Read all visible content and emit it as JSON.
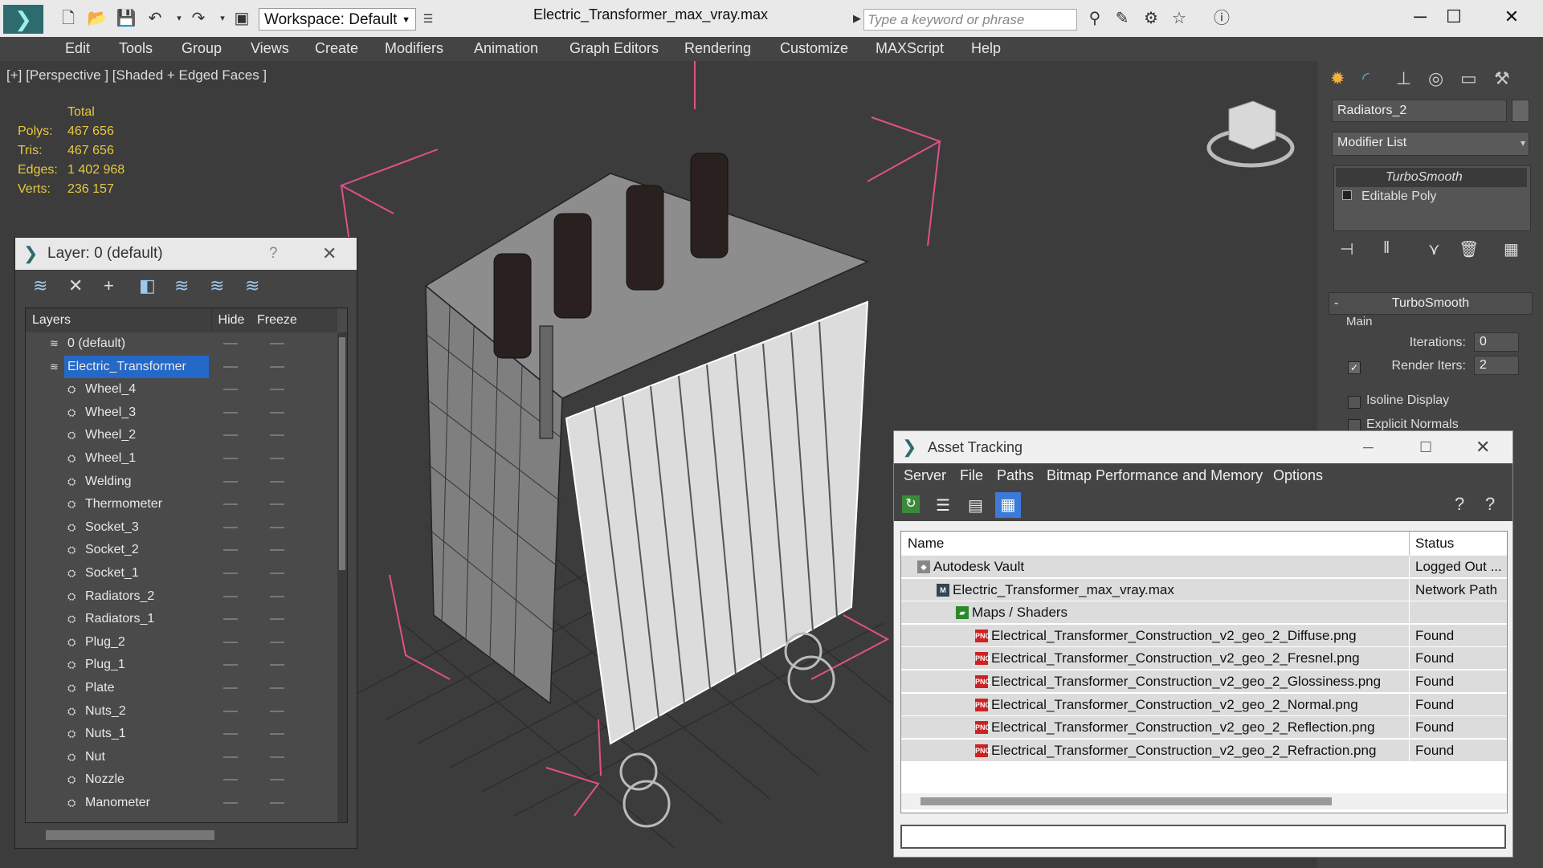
{
  "app": {
    "window_title": "Electric_Transformer_max_vray.max",
    "workspace": "Workspace: Default",
    "search_placeholder": "Type a keyword or phrase"
  },
  "menu": [
    "Edit",
    "Tools",
    "Group",
    "Views",
    "Create",
    "Modifiers",
    "Animation",
    "Graph Editors",
    "Rendering",
    "Customize",
    "MAXScript",
    "Help"
  ],
  "viewport": {
    "label": "[+] [Perspective ] [Shaded + Edged Faces ]",
    "stats": {
      "header": "Total",
      "rows": [
        {
          "k": "Polys:",
          "v": "467 656"
        },
        {
          "k": "Tris:",
          "v": "467 656"
        },
        {
          "k": "Edges:",
          "v": "1 402 968"
        },
        {
          "k": "Verts:",
          "v": "236 157"
        }
      ]
    }
  },
  "command_panel": {
    "object_name": "Radiators_2",
    "modifier_list": "Modifier List",
    "stack": [
      "TurboSmooth",
      "Editable Poly"
    ],
    "rollout_title": "TurboSmooth",
    "group_main": "Main",
    "iterations_label": "Iterations:",
    "iterations_value": "0",
    "render_iters_label": "Render Iters:",
    "render_iters_value": "2",
    "isoline_label": "Isoline Display",
    "explicit_label": "Explicit Normals"
  },
  "layer_dialog": {
    "title": "Layer: 0 (default)",
    "help": "?",
    "col_layers": "Layers",
    "col_hide": "Hide",
    "col_freeze": "Freeze",
    "rows": [
      {
        "name": "0 (default)",
        "level": 0
      },
      {
        "name": "Electric_Transformer",
        "level": 0,
        "selected": true
      },
      {
        "name": "Wheel_4",
        "level": 1
      },
      {
        "name": "Wheel_3",
        "level": 1
      },
      {
        "name": "Wheel_2",
        "level": 1
      },
      {
        "name": "Wheel_1",
        "level": 1
      },
      {
        "name": "Welding",
        "level": 1
      },
      {
        "name": "Thermometer",
        "level": 1
      },
      {
        "name": "Socket_3",
        "level": 1
      },
      {
        "name": "Socket_2",
        "level": 1
      },
      {
        "name": "Socket_1",
        "level": 1
      },
      {
        "name": "Radiators_2",
        "level": 1
      },
      {
        "name": "Radiators_1",
        "level": 1
      },
      {
        "name": "Plug_2",
        "level": 1
      },
      {
        "name": "Plug_1",
        "level": 1
      },
      {
        "name": "Plate",
        "level": 1
      },
      {
        "name": "Nuts_2",
        "level": 1
      },
      {
        "name": "Nuts_1",
        "level": 1
      },
      {
        "name": "Nut",
        "level": 1
      },
      {
        "name": "Nozzle",
        "level": 1
      },
      {
        "name": "Manometer",
        "level": 1
      }
    ]
  },
  "asset_dialog": {
    "title": "Asset Tracking",
    "menu": [
      "Server",
      "File",
      "Paths",
      "Bitmap Performance and Memory",
      "Options"
    ],
    "col_name": "Name",
    "col_status": "Status",
    "rows": [
      {
        "name": "Autodesk Vault",
        "status": "Logged Out ...",
        "indent": 40,
        "icon": "vault"
      },
      {
        "name": "Electric_Transformer_max_vray.max",
        "status": "Network Path",
        "indent": 64,
        "icon": "max"
      },
      {
        "name": "Maps / Shaders",
        "status": "",
        "indent": 88,
        "icon": "maps"
      },
      {
        "name": "Electrical_Transformer_Construction_v2_geo_2_Diffuse.png",
        "status": "Found",
        "indent": 112,
        "icon": "png"
      },
      {
        "name": "Electrical_Transformer_Construction_v2_geo_2_Fresnel.png",
        "status": "Found",
        "indent": 112,
        "icon": "png"
      },
      {
        "name": "Electrical_Transformer_Construction_v2_geo_2_Glossiness.png",
        "status": "Found",
        "indent": 112,
        "icon": "png"
      },
      {
        "name": "Electrical_Transformer_Construction_v2_geo_2_Normal.png",
        "status": "Found",
        "indent": 112,
        "icon": "png"
      },
      {
        "name": "Electrical_Transformer_Construction_v2_geo_2_Reflection.png",
        "status": "Found",
        "indent": 112,
        "icon": "png"
      },
      {
        "name": "Electrical_Transformer_Construction_v2_geo_2_Refraction.png",
        "status": "Found",
        "indent": 112,
        "icon": "png"
      }
    ]
  },
  "colors": {
    "selection": "#2468c8",
    "stats_text": "#e8c840",
    "gizmo": "#e0508a"
  }
}
